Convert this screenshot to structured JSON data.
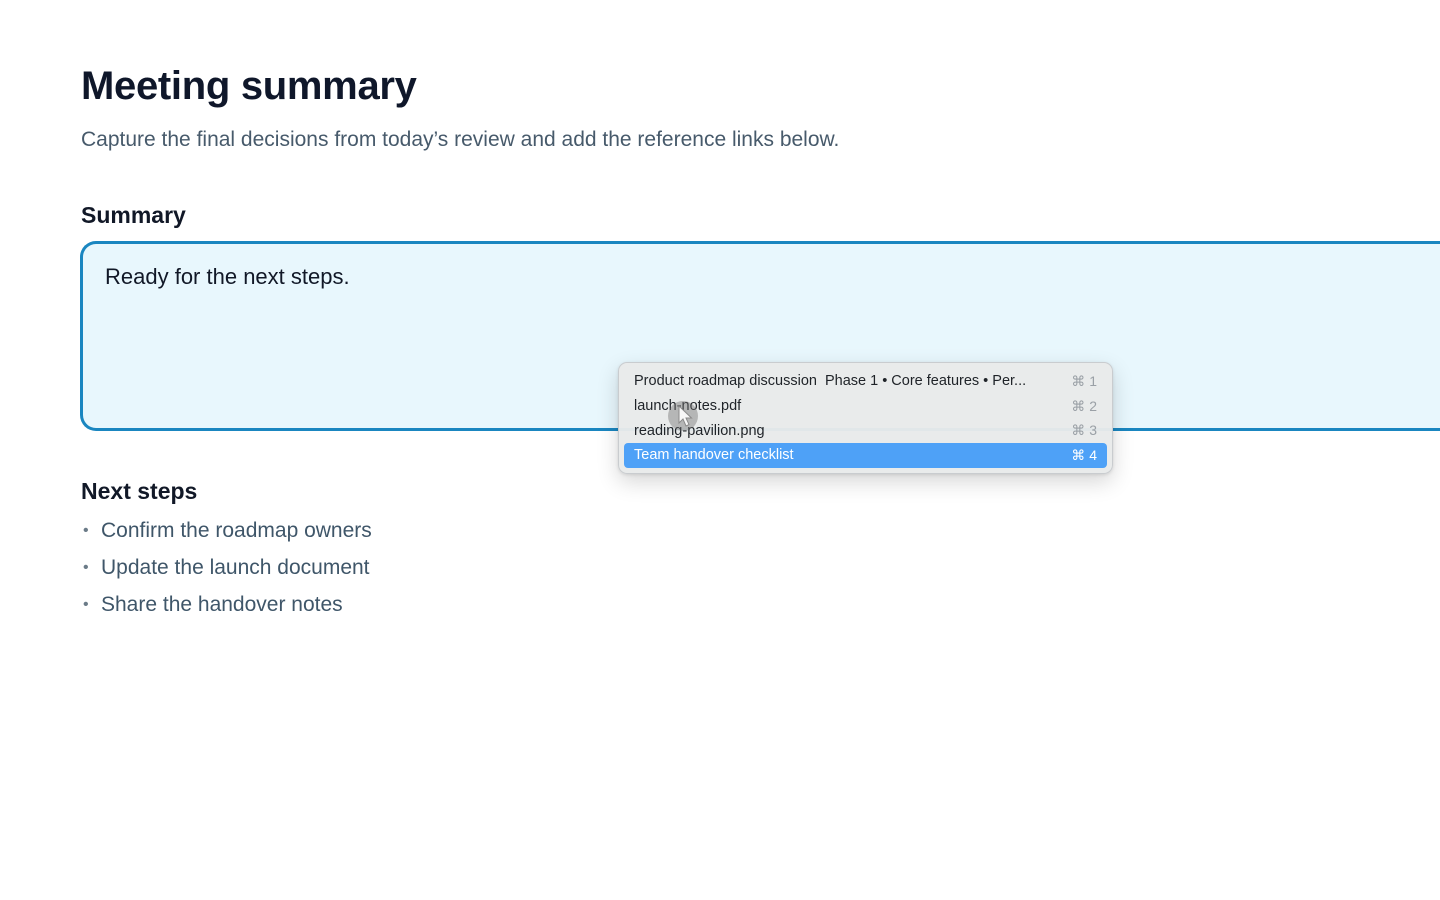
{
  "page": {
    "title": "Meeting summary",
    "subtitle": "Capture the final decisions from today’s review and add the reference links below."
  },
  "summary": {
    "heading": "Summary",
    "text": "Ready for the next steps."
  },
  "next_steps": {
    "heading": "Next steps",
    "bullet": "•",
    "items": [
      "Confirm the roadmap owners",
      "Update the launch document",
      "Share the handover notes"
    ]
  },
  "popup_menu": {
    "items": [
      {
        "label": "Product roadmap discussion",
        "detail": "Phase 1 • Core features • Per...",
        "shortcut": "⌘ 1"
      },
      {
        "label": "launch-notes.pdf",
        "detail": "",
        "shortcut": "⌘ 2"
      },
      {
        "label": "reading-pavilion.png",
        "detail": "",
        "shortcut": "⌘ 3"
      },
      {
        "label": "Team handover checklist",
        "detail": "",
        "shortcut": "⌘ 4",
        "selected": true
      }
    ]
  },
  "colors": {
    "accent_border": "#1a86c0",
    "summary_background": "#e8f7fd",
    "selection": "#4ea1f7"
  },
  "icons": {
    "cursor": "pointer-cursor-icon"
  }
}
